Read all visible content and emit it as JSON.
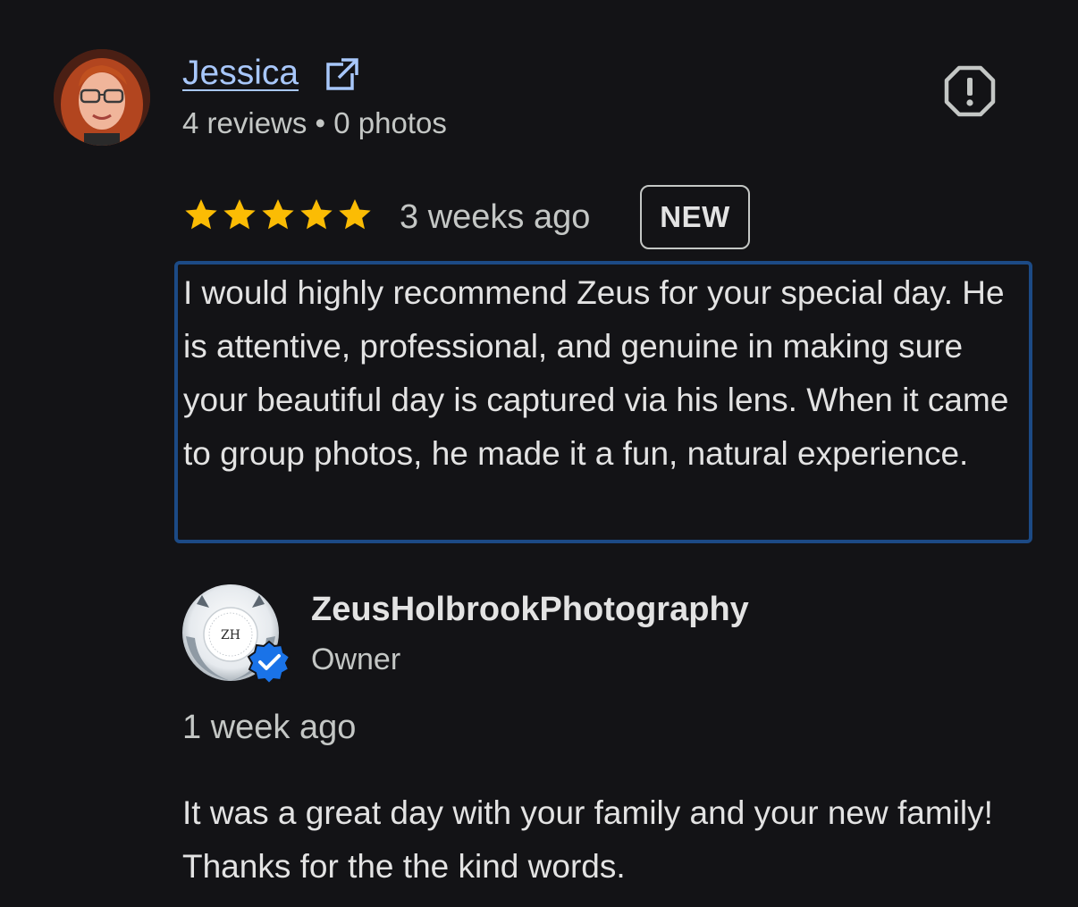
{
  "reviewer": {
    "name": "Jessica",
    "meta": "4 reviews • 0 photos",
    "avatar_icon": "profile-photo",
    "link_icon": "external-link-icon"
  },
  "review": {
    "rating": 5,
    "rating_max": 5,
    "star_color": "#fbbc04",
    "date": "3 weeks ago",
    "badge": "NEW",
    "text": "I would highly recommend Zeus for your special day. He is attentive, professional, and genuine in making sure your beautiful day is captured via his lens. When it came to group photos, he made it a fun, natural experience.",
    "highlight_color": "#1c4a85"
  },
  "reply": {
    "owner_name": "ZeusHolbrookPhotography",
    "owner_role": "Owner",
    "logo_text": "ZH",
    "verified_color": "#1a73e8",
    "date": "1 week ago",
    "text": "It was a great day with your family and your new family! Thanks for the the kind words."
  },
  "icons": {
    "report": "report-icon",
    "star": "star-icon",
    "verified": "verified-badge-icon"
  },
  "colors": {
    "background": "#131316",
    "link": "#a8c7fa",
    "text": "#e3e3e3",
    "muted": "#c4c7c5"
  }
}
